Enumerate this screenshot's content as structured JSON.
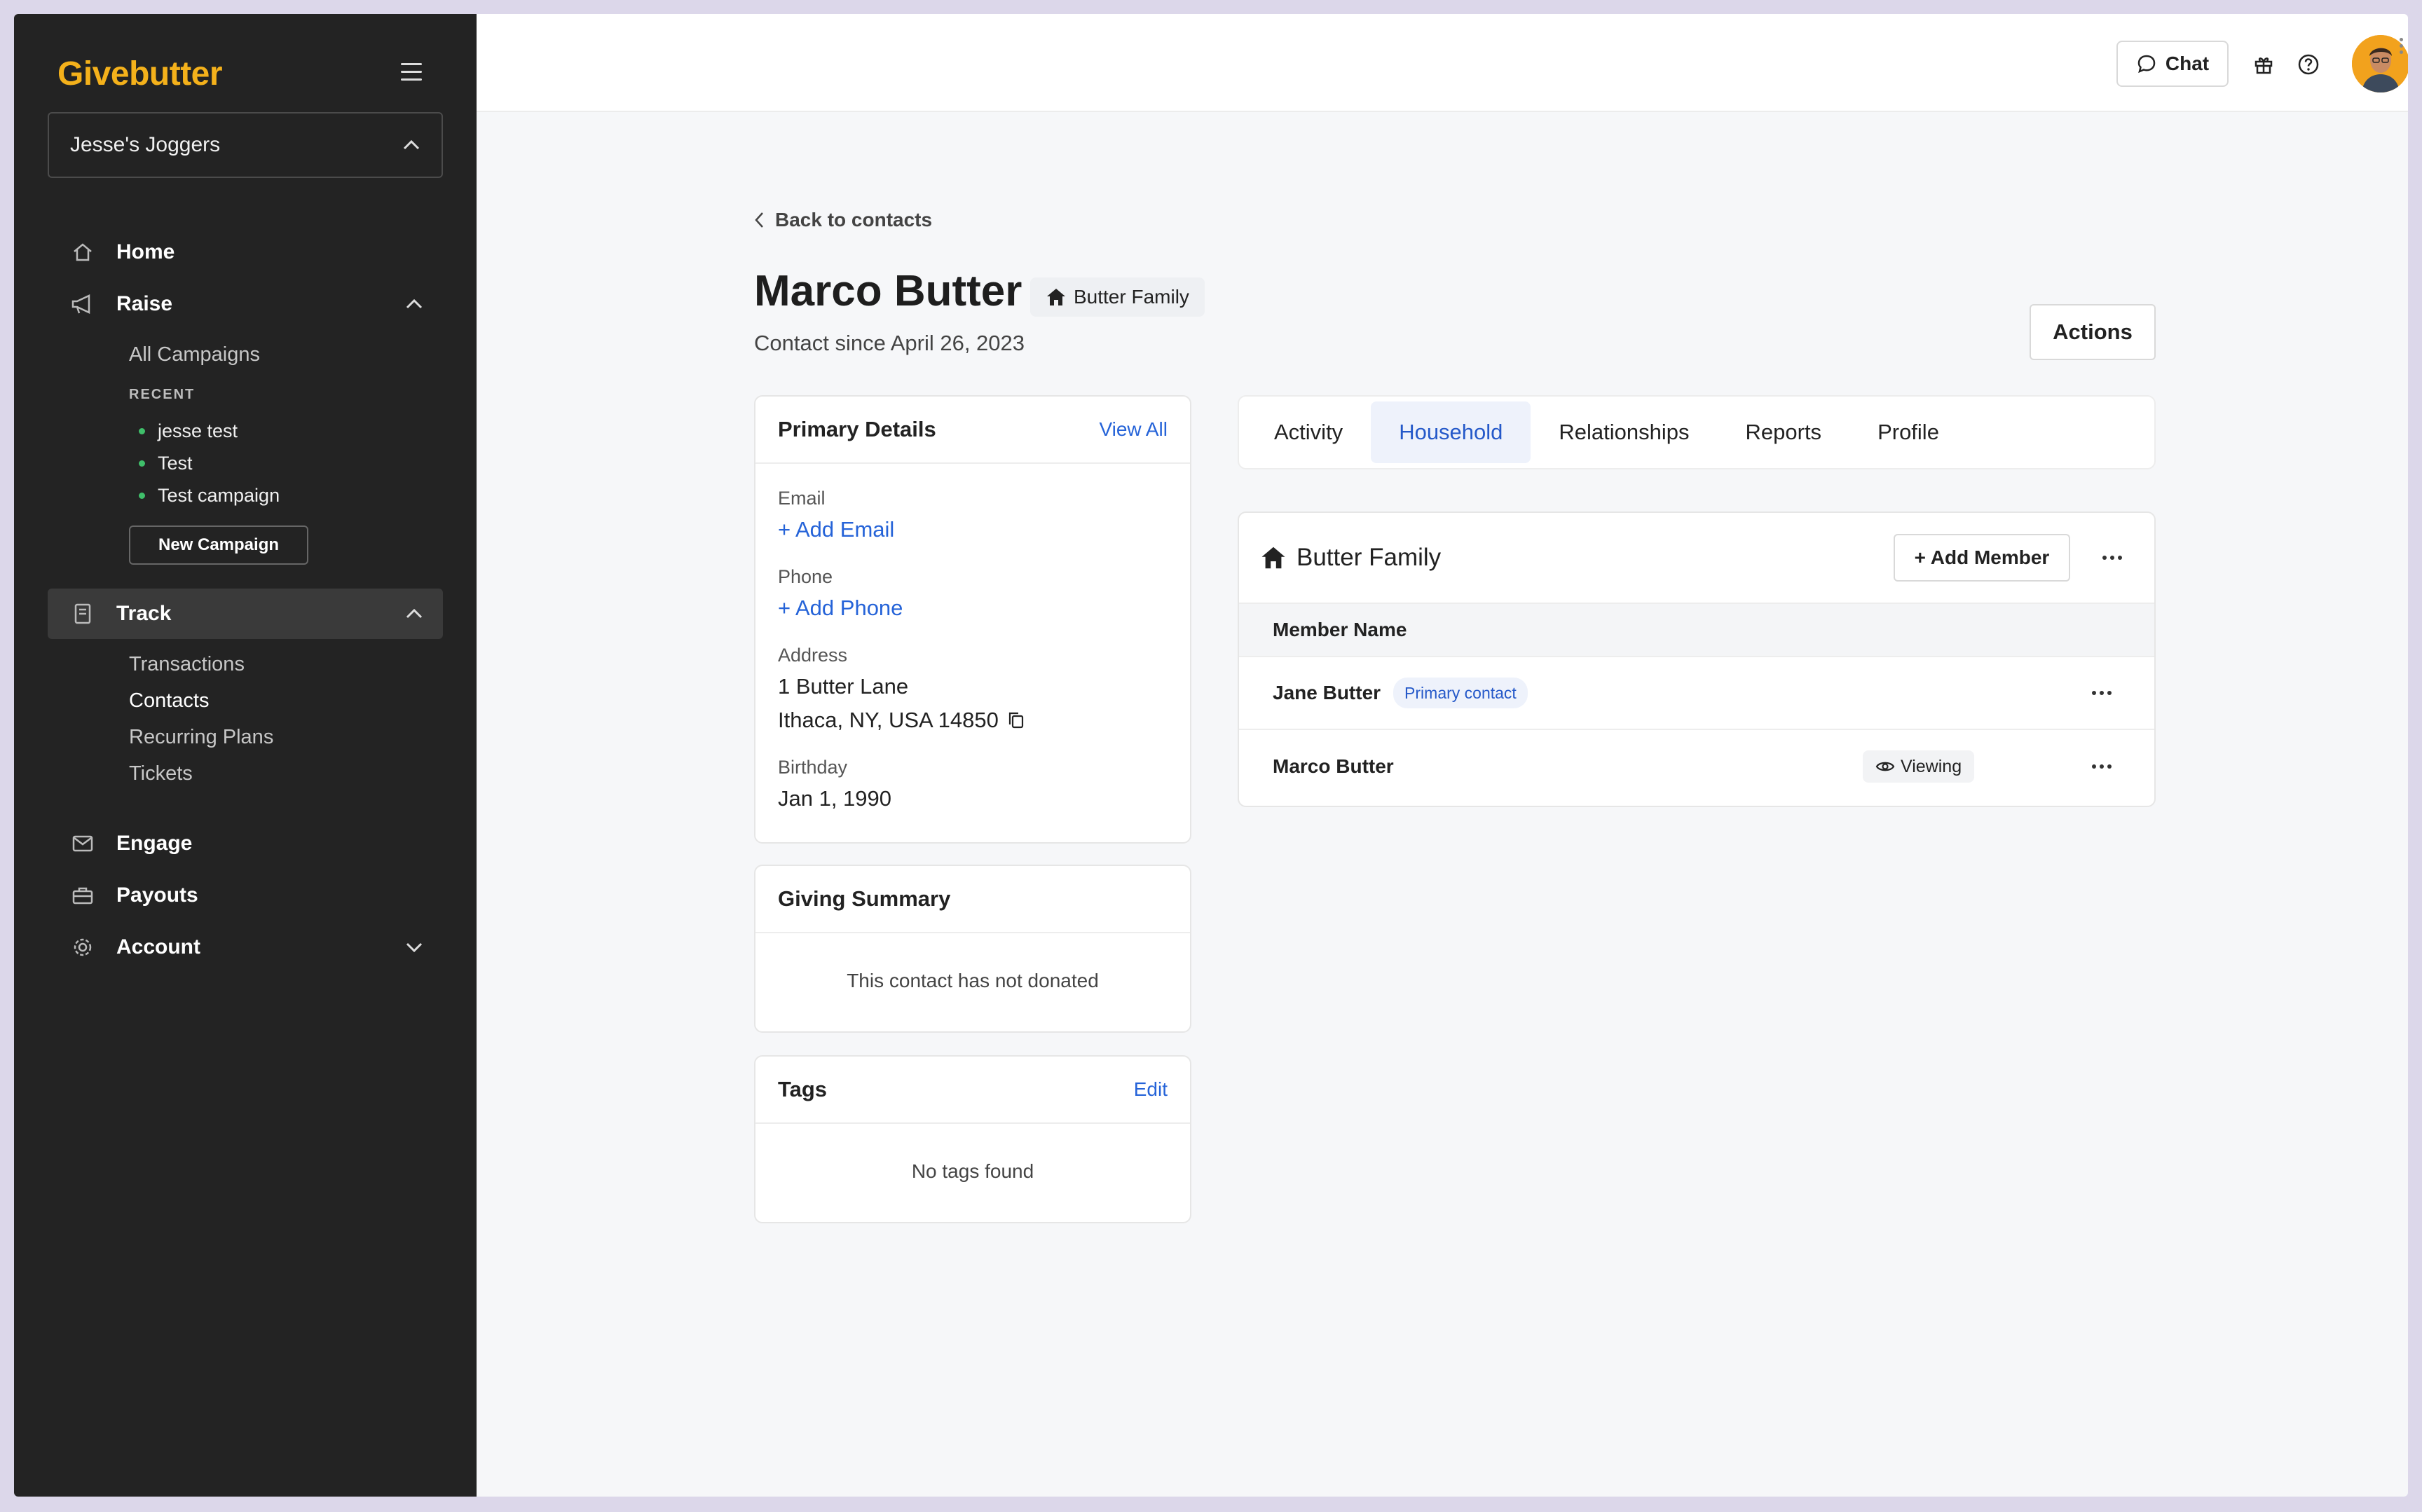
{
  "app": {
    "brand": "Givebutter",
    "brand_color": "#f4b11b",
    "accent_color": "#2563d8"
  },
  "sidebar": {
    "org_name": "Jesse's Joggers",
    "nav": {
      "home": "Home",
      "raise": "Raise",
      "track": "Track",
      "engage": "Engage",
      "payouts": "Payouts",
      "account": "Account"
    },
    "raise_sub": {
      "all_campaigns": "All Campaigns",
      "recent_label": "RECENT"
    },
    "recent": [
      "jesse test",
      "Test",
      "Test campaign"
    ],
    "new_campaign": "New Campaign",
    "track_sub": [
      "Transactions",
      "Contacts",
      "Recurring Plans",
      "Tickets"
    ],
    "current_track_item": "Contacts"
  },
  "topbar": {
    "chat": "Chat",
    "icons": [
      "gift-icon",
      "help-icon"
    ]
  },
  "contact": {
    "back": "Back to contacts",
    "name": "Marco Butter",
    "household": "Butter Family",
    "since": "Contact since April 26, 2023",
    "actions": "Actions"
  },
  "primary_details": {
    "title": "Primary Details",
    "view_all": "View All",
    "email_label": "Email",
    "add_email": "+ Add Email",
    "phone_label": "Phone",
    "add_phone": "+ Add Phone",
    "address_label": "Address",
    "address_line1": "1 Butter Lane",
    "address_line2": "Ithaca, NY, USA 14850",
    "birthday_label": "Birthday",
    "birthday": "Jan 1, 1990"
  },
  "giving_summary": {
    "title": "Giving Summary",
    "message": "This contact has not donated"
  },
  "tags": {
    "title": "Tags",
    "edit": "Edit",
    "message": "No tags found"
  },
  "tabs": [
    "Activity",
    "Household",
    "Relationships",
    "Reports",
    "Profile"
  ],
  "active_tab": "Household",
  "household": {
    "title": "Butter Family",
    "add_member": "+ Add Member",
    "column": "Member Name",
    "members": [
      {
        "name": "Jane Butter",
        "badge": "Primary contact"
      },
      {
        "name": "Marco Butter",
        "badge": "Viewing"
      }
    ]
  }
}
